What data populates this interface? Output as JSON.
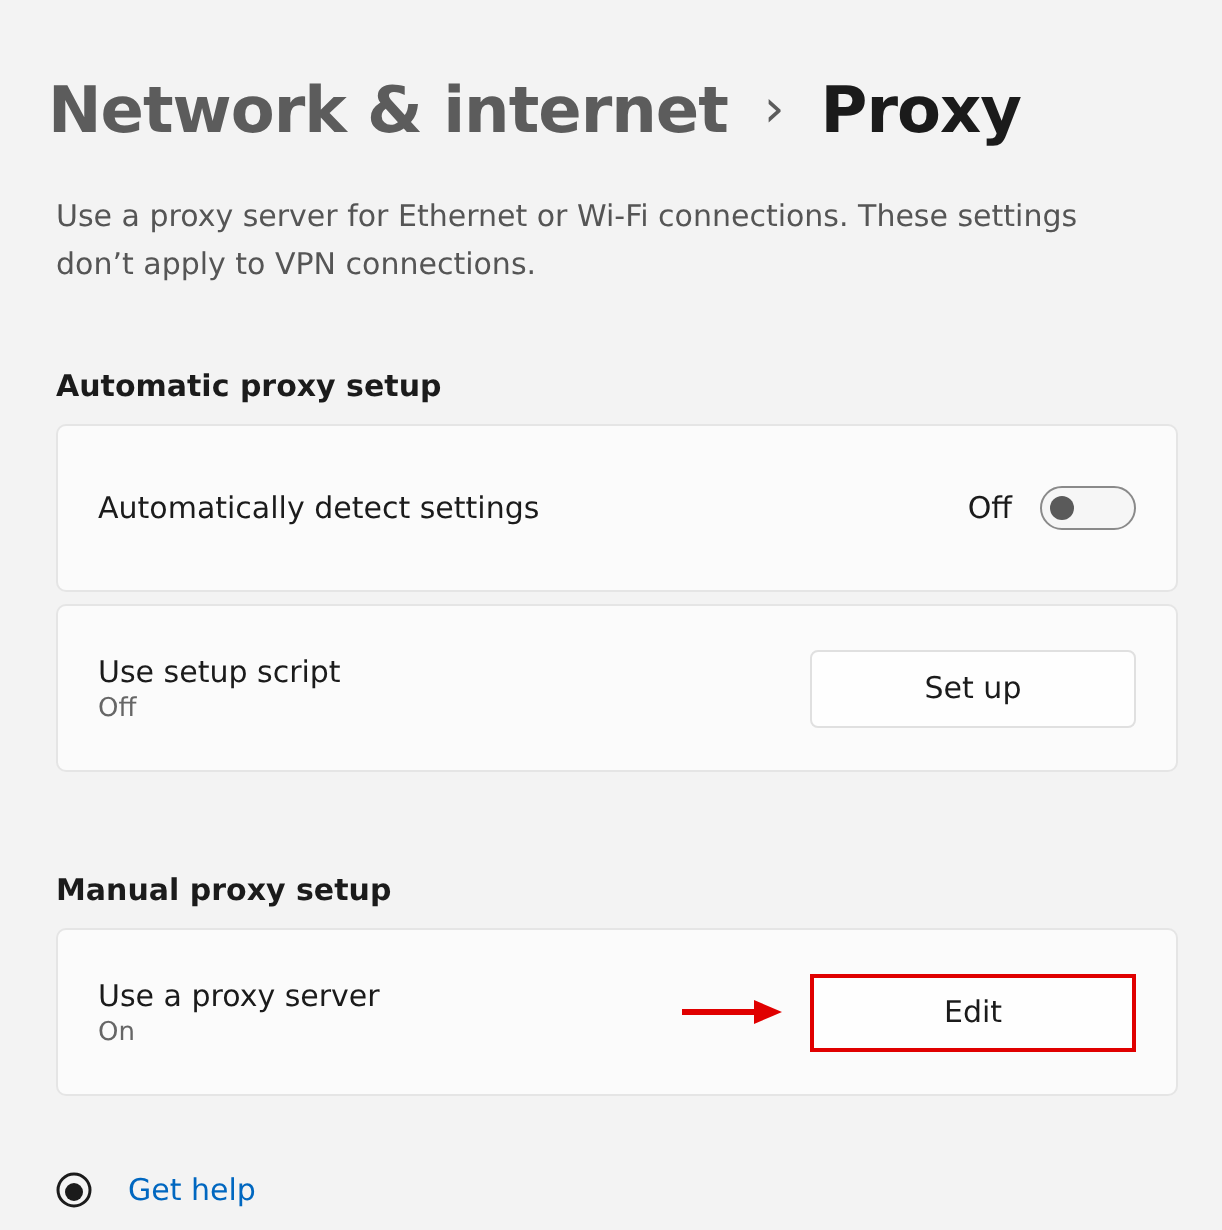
{
  "breadcrumb": {
    "parent": "Network & internet",
    "separator": "›",
    "current": "Proxy"
  },
  "description": "Use a proxy server for Ethernet or Wi-Fi connections. These settings don’t apply to VPN connections.",
  "sections": [
    {
      "heading": "Automatic proxy setup",
      "rows": [
        {
          "kind": "toggle",
          "label": "Automatically detect settings",
          "on": false,
          "state_text": "Off"
        },
        {
          "kind": "button",
          "label": "Use setup script",
          "subtitle": "Off",
          "button": "Set up",
          "highlighted": false
        }
      ]
    },
    {
      "heading": "Manual proxy setup",
      "rows": [
        {
          "kind": "button",
          "label": "Use a proxy server",
          "subtitle": "On",
          "button": "Edit",
          "highlighted": true
        }
      ]
    }
  ],
  "help_link": "Get help"
}
